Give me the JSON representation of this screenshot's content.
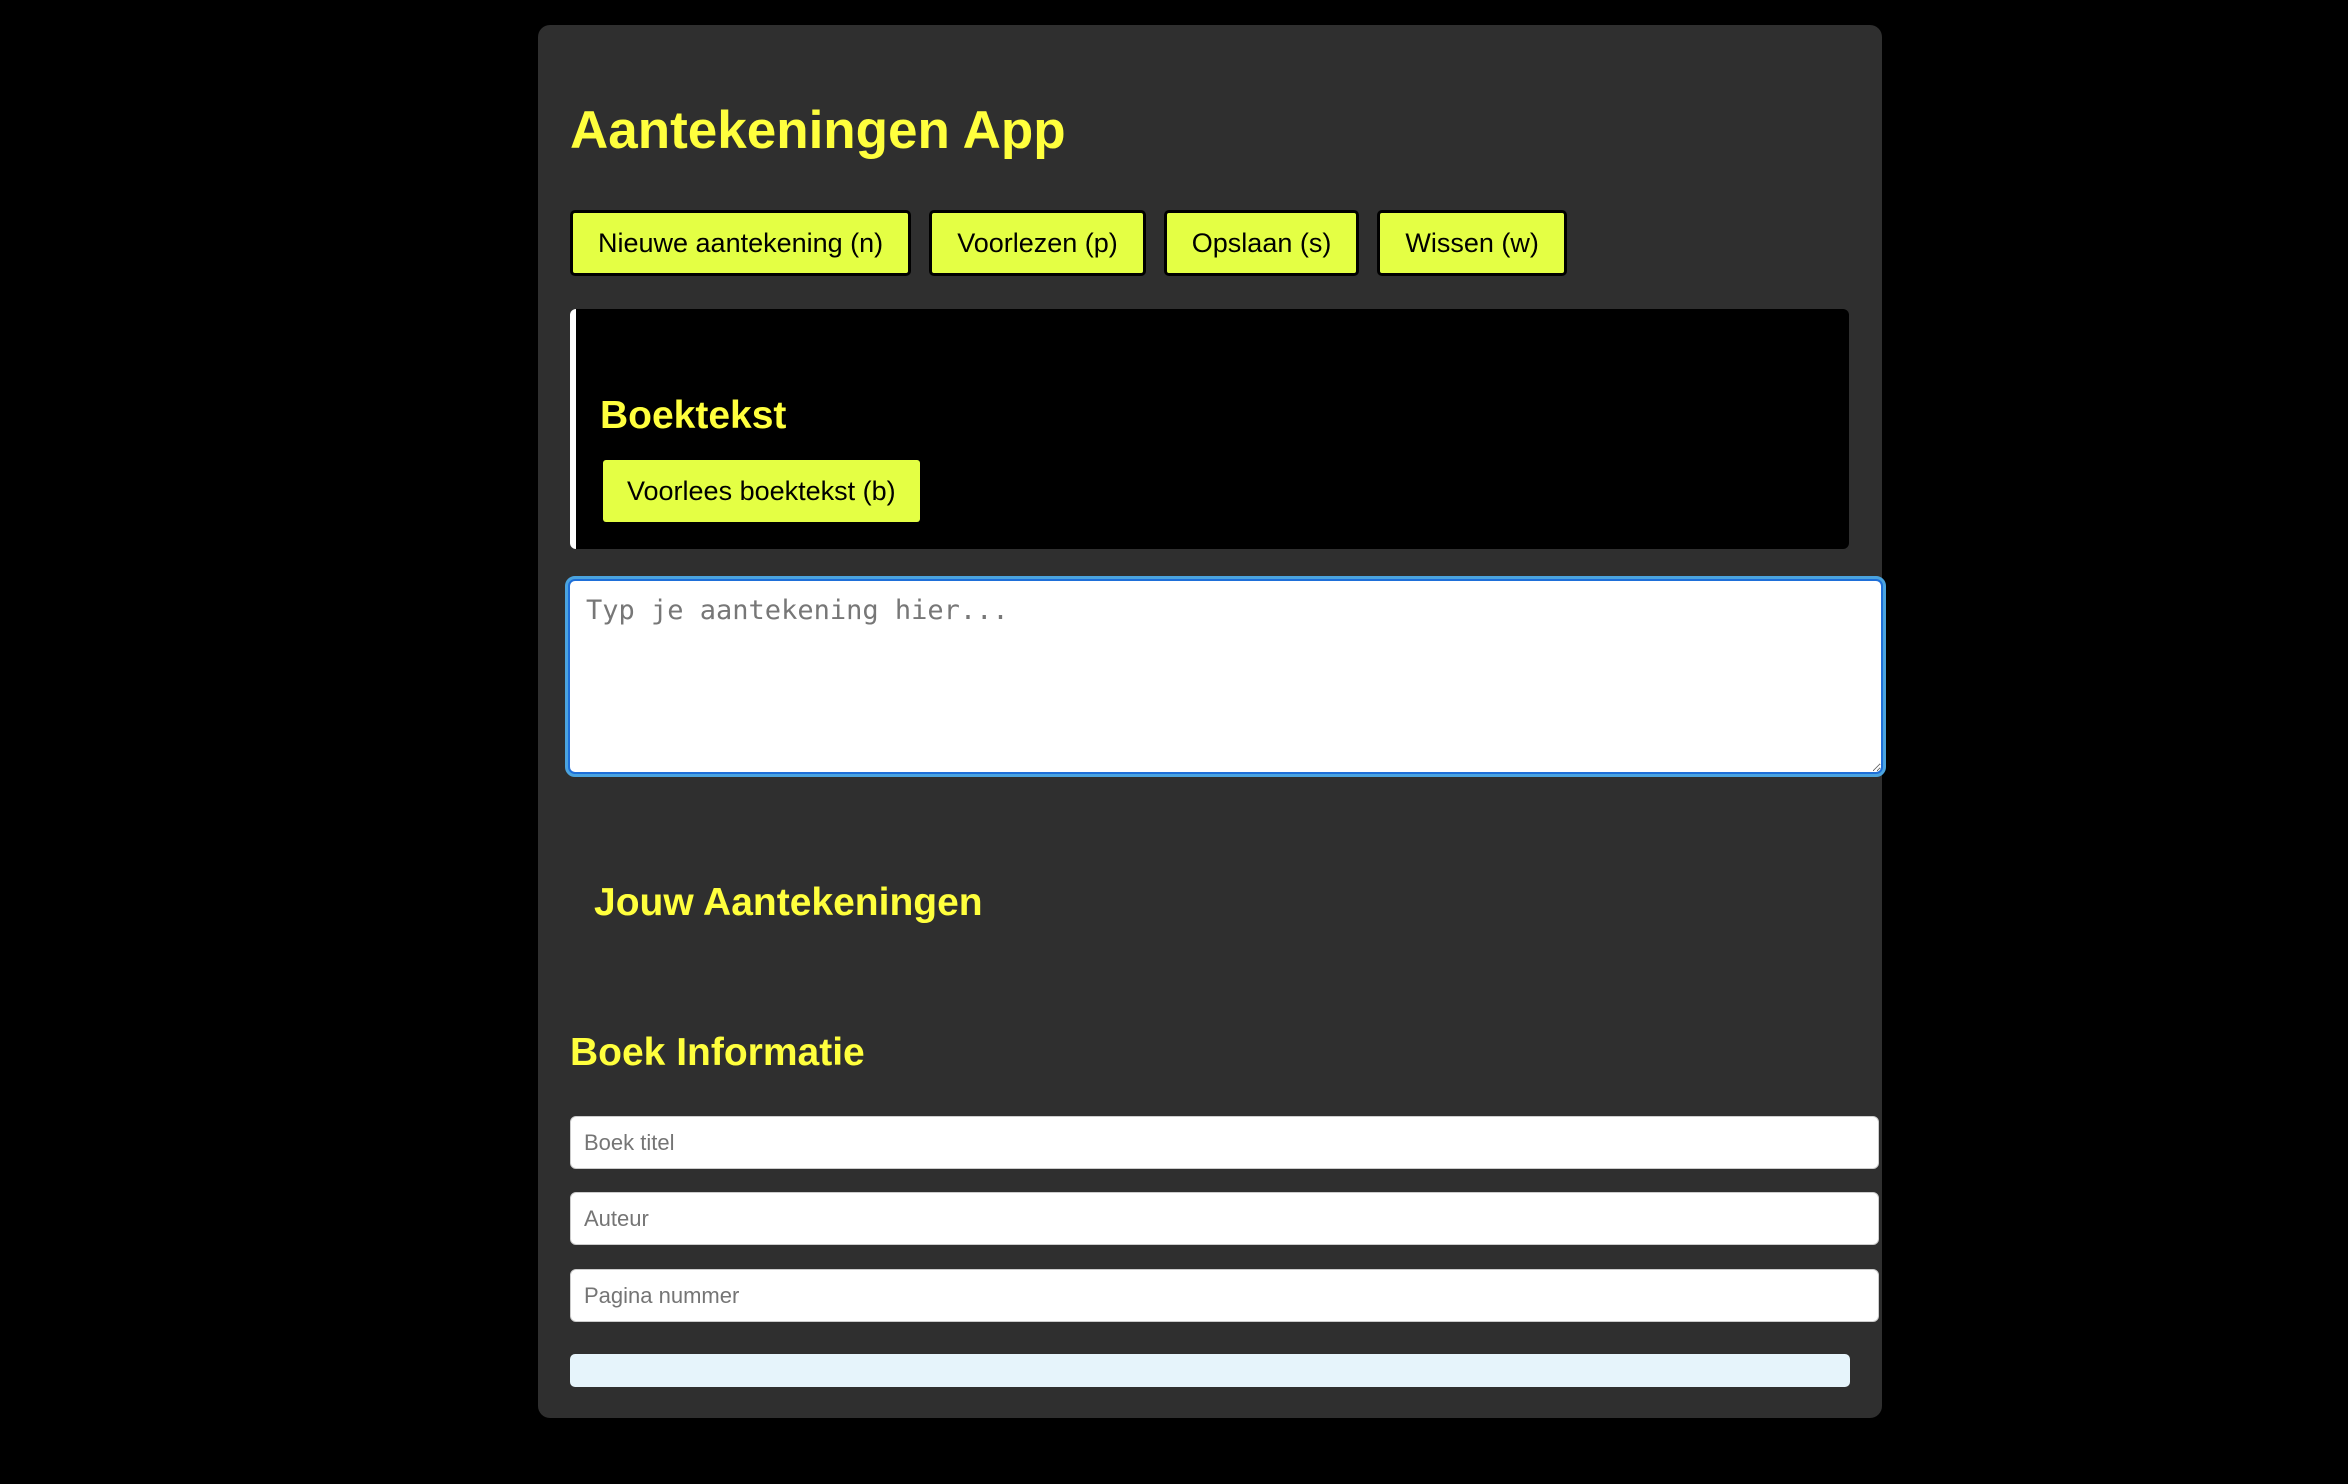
{
  "app": {
    "title": "Aantekeningen App"
  },
  "toolbar": {
    "new_note": "Nieuwe aantekening (n)",
    "read_aloud": "Voorlezen (p)",
    "save": "Opslaan (s)",
    "clear": "Wissen (w)"
  },
  "booktext": {
    "title": "Boektekst",
    "read_button": "Voorlees boektekst (b)"
  },
  "note_editor": {
    "value": "",
    "placeholder": "Typ je aantekening hier..."
  },
  "notes": {
    "title": "Jouw Aantekeningen",
    "items": []
  },
  "book_info": {
    "title": "Boek Informatie",
    "title_field": {
      "value": "",
      "placeholder": "Boek titel"
    },
    "author_field": {
      "value": "",
      "placeholder": "Auteur"
    },
    "page_field": {
      "value": "",
      "placeholder": "Pagina nummer"
    }
  },
  "status": {
    "text": ""
  },
  "colors": {
    "background": "#000000",
    "panel": "#2f2f2f",
    "heading": "#ffff3d",
    "button": "#e4ff44",
    "focus": "#4aa3df",
    "status_bar": "#e6f4fb"
  }
}
